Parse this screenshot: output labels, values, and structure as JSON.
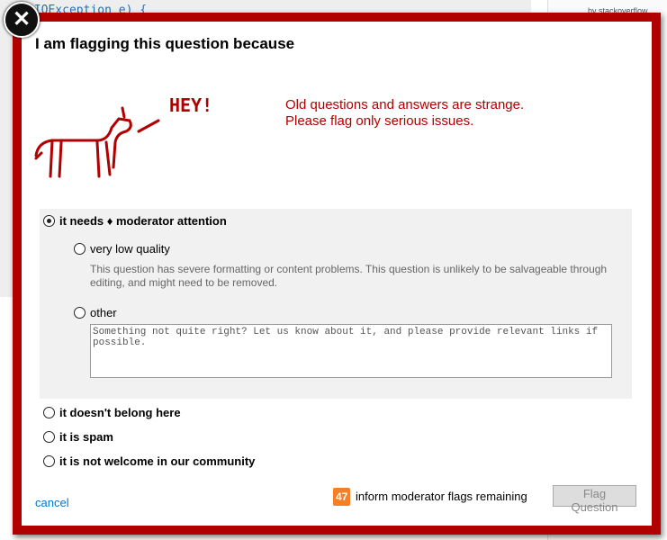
{
  "background": {
    "code_fragment": "(IOException e) {",
    "brand": "by stackoverflow"
  },
  "dialog": {
    "title": "I am flagging this question because",
    "doodle_text": "HEY!",
    "warning_line1": "Old questions and answers are strange.",
    "warning_line2": "Please flag only serious issues.",
    "options": [
      {
        "label": "it needs ♦ moderator attention",
        "selected": true,
        "sub_options": [
          {
            "label": "very low quality",
            "description": "This question has severe formatting or content problems. This question is unlikely to be salvageable through editing, and might need to be removed.",
            "selected": false
          },
          {
            "label": "other",
            "placeholder": "Something not quite right? Let us know about it, and please provide relevant links if possible.",
            "value": "",
            "selected": false
          }
        ]
      },
      {
        "label": "it doesn't belong here",
        "selected": false
      },
      {
        "label": "it is spam",
        "selected": false
      },
      {
        "label": "it is not welcome in our community",
        "selected": false
      }
    ],
    "cancel_label": "cancel",
    "flags_remaining": "47",
    "flags_remaining_label": "inform moderator flags remaining",
    "submit_label": "Flag Question",
    "accent_color": "#b00000",
    "badge_color": "#f47f24"
  }
}
